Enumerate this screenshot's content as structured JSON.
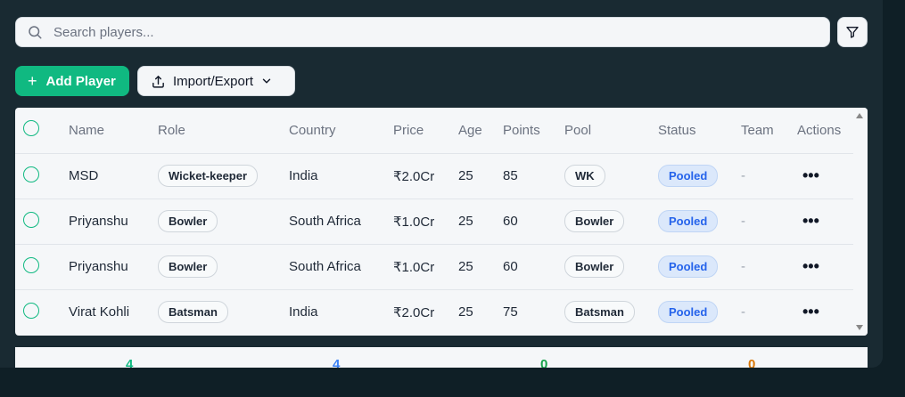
{
  "search": {
    "placeholder": "Search players..."
  },
  "icons": {
    "search": "search-icon",
    "filter": "filter-icon",
    "plus": "plus-icon",
    "upload": "upload-icon",
    "chevron": "chevron-down-icon",
    "more": "more-horizontal-icon"
  },
  "toolbar": {
    "add_label": "Add Player",
    "io_label": "Import/Export"
  },
  "table": {
    "columns": [
      "Name",
      "Role",
      "Country",
      "Price",
      "Age",
      "Points",
      "Pool",
      "Status",
      "Team",
      "Actions"
    ],
    "rows": [
      {
        "name": "MSD",
        "role": "Wicket-keeper",
        "country": "India",
        "price": "₹2.0Cr",
        "age": "25",
        "points": "85",
        "pool": "WK",
        "status": "Pooled",
        "team": "-"
      },
      {
        "name": "Priyanshu",
        "role": "Bowler",
        "country": "South Africa",
        "price": "₹1.0Cr",
        "age": "25",
        "points": "60",
        "pool": "Bowler",
        "status": "Pooled",
        "team": "-"
      },
      {
        "name": "Priyanshu",
        "role": "Bowler",
        "country": "South Africa",
        "price": "₹1.0Cr",
        "age": "25",
        "points": "60",
        "pool": "Bowler",
        "status": "Pooled",
        "team": "-"
      },
      {
        "name": "Virat Kohli",
        "role": "Batsman",
        "country": "India",
        "price": "₹2.0Cr",
        "age": "25",
        "points": "75",
        "pool": "Batsman",
        "status": "Pooled",
        "team": "-"
      }
    ],
    "actions_glyph": "•••"
  },
  "stats": [
    {
      "value": "4",
      "color": "#10b981"
    },
    {
      "value": "4",
      "color": "#3b82f6"
    },
    {
      "value": "0",
      "color": "#16a34a"
    },
    {
      "value": "0",
      "color": "#d97706"
    }
  ],
  "colors": {
    "accent": "#10b981",
    "status_text": "#2563eb",
    "background": "#192a32"
  }
}
